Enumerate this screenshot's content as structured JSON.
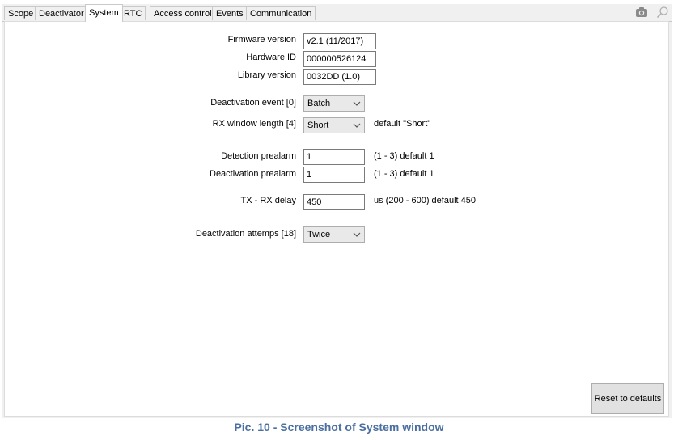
{
  "tabs": [
    "Scope",
    "Deactivator",
    "System",
    "RTC",
    "Access control",
    "Events",
    "Communication"
  ],
  "active_tab": "System",
  "toolbar_icons": [
    "camera-icon",
    "search-icon"
  ],
  "fields": {
    "firmware_version": {
      "label": "Firmware version",
      "value": "v2.1 (11/2017)"
    },
    "hardware_id": {
      "label": "Hardware ID",
      "value": "000000526124"
    },
    "library_version": {
      "label": "Library version",
      "value": "0032DD (1.0)"
    },
    "deactivation_event": {
      "label": "Deactivation event [0]",
      "value": "Batch"
    },
    "rx_window_length": {
      "label": "RX window length [4]",
      "value": "Short",
      "hint": "default \"Short\""
    },
    "detection_prealarm": {
      "label": "Detection prealarm",
      "value": "1",
      "hint": "(1 - 3) default 1"
    },
    "deactivation_prealarm": {
      "label": "Deactivation prealarm",
      "value": "1",
      "hint": "(1 - 3) default 1"
    },
    "tx_rx_delay": {
      "label": "TX - RX delay",
      "value": "450",
      "hint": "us (200 - 600) default 450"
    },
    "deactivation_attempts": {
      "label": "Deactivation attemps [18]",
      "value": "Twice"
    }
  },
  "reset_button": "Reset to defaults",
  "caption": "Pic. 10 - Screenshot of System window"
}
